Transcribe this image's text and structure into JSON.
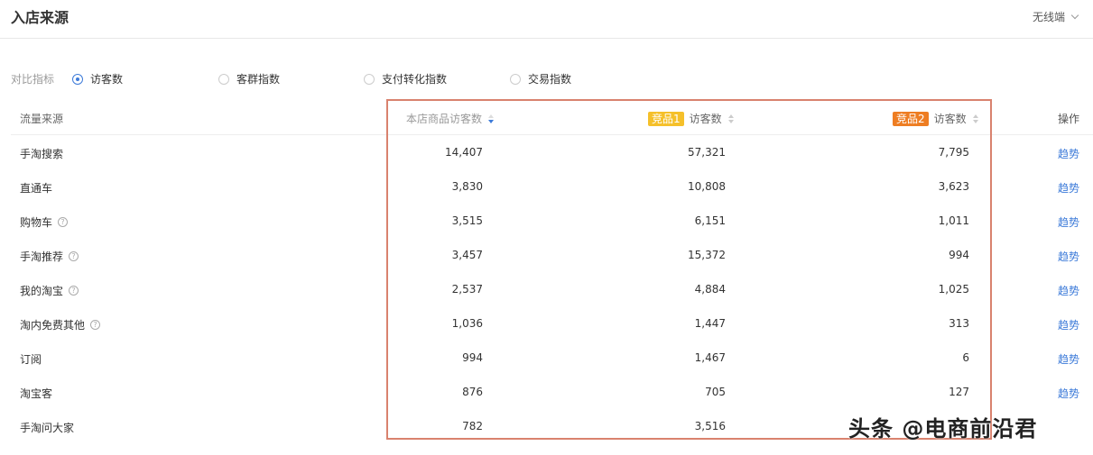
{
  "header": {
    "title": "入店来源",
    "device": "无线端"
  },
  "metrics": {
    "label": "对比指标",
    "options": [
      {
        "label": "访客数",
        "checked": true
      },
      {
        "label": "客群指数",
        "checked": false
      },
      {
        "label": "支付转化指数",
        "checked": false
      },
      {
        "label": "交易指数",
        "checked": false
      }
    ]
  },
  "table": {
    "headers": {
      "source": "流量来源",
      "own": "本店商品访客数",
      "competitor1_badge": "竞品1",
      "competitor1_label": "访客数",
      "competitor2_badge": "竞品2",
      "competitor2_label": "访客数",
      "action": "操作"
    },
    "rows": [
      {
        "source": "手淘搜索",
        "help": false,
        "own": "14,407",
        "c1": "57,321",
        "c2": "7,795",
        "action": "趋势"
      },
      {
        "source": "直通车",
        "help": false,
        "own": "3,830",
        "c1": "10,808",
        "c2": "3,623",
        "action": "趋势"
      },
      {
        "source": "购物车",
        "help": true,
        "own": "3,515",
        "c1": "6,151",
        "c2": "1,011",
        "action": "趋势"
      },
      {
        "source": "手淘推荐",
        "help": true,
        "own": "3,457",
        "c1": "15,372",
        "c2": "994",
        "action": "趋势"
      },
      {
        "source": "我的淘宝",
        "help": true,
        "own": "2,537",
        "c1": "4,884",
        "c2": "1,025",
        "action": "趋势"
      },
      {
        "source": "淘内免费其他",
        "help": true,
        "own": "1,036",
        "c1": "1,447",
        "c2": "313",
        "action": "趋势"
      },
      {
        "source": "订阅",
        "help": false,
        "own": "994",
        "c1": "1,467",
        "c2": "6",
        "action": "趋势"
      },
      {
        "source": "淘宝客",
        "help": false,
        "own": "876",
        "c1": "705",
        "c2": "127",
        "action": "趋势"
      },
      {
        "source": "手淘问大家",
        "help": false,
        "own": "782",
        "c1": "3,516",
        "c2": "",
        "action": ""
      }
    ]
  },
  "watermark": "头条 @电商前沿君",
  "colors": {
    "accent": "#3d7bd9",
    "badge1": "#f5c02a",
    "badge2": "#ee7d22",
    "highlight": "#d9826e"
  }
}
